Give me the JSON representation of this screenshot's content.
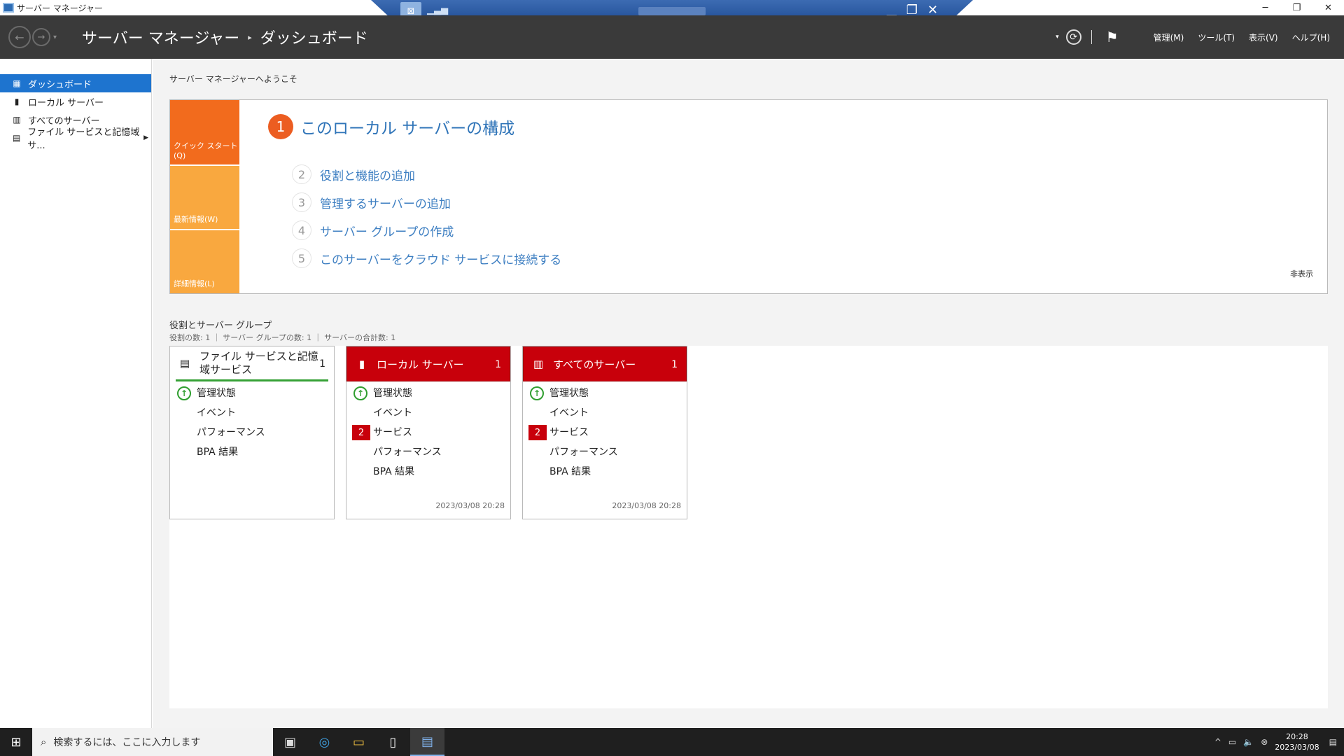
{
  "window": {
    "title": "サーバー マネージャー",
    "minimize": "─",
    "restore": "❐",
    "close": "✕"
  },
  "rdp": {
    "pin": "⊠",
    "signal": "▁▃▅",
    "min": "▁",
    "restore": "❐",
    "close": "✕"
  },
  "header": {
    "back": "←",
    "forward": "→",
    "nav_dropdown": "▾",
    "breadcrumb_root": "サーバー マネージャー",
    "breadcrumb_sep": "▸",
    "breadcrumb_current": "ダッシュボード",
    "dropdown": "▾",
    "refresh": "⟳",
    "flag": "⚑",
    "menus": [
      "管理(M)",
      "ツール(T)",
      "表示(V)",
      "ヘルプ(H)"
    ]
  },
  "sidebar": {
    "items": [
      {
        "label": "ダッシュボード",
        "icon": "dashboard-icon"
      },
      {
        "label": "ローカル サーバー",
        "icon": "server-icon"
      },
      {
        "label": "すべてのサーバー",
        "icon": "servers-icon"
      },
      {
        "label": "ファイル サービスと記憶域サ...",
        "icon": "file-services-icon"
      }
    ]
  },
  "welcome": "サーバー マネージャーへようこそ",
  "quickstart": {
    "tabs": [
      "クイック スタート(Q)",
      "最新情報(W)",
      "詳細情報(L)"
    ],
    "step1_num": "1",
    "step1_label": "このローカル サーバーの構成",
    "steps": [
      {
        "num": "2",
        "label": "役割と機能の追加"
      },
      {
        "num": "3",
        "label": "管理するサーバーの追加"
      },
      {
        "num": "4",
        "label": "サーバー グループの作成"
      },
      {
        "num": "5",
        "label": "このサーバーをクラウド サービスに接続する"
      }
    ],
    "hide": "非表示"
  },
  "roles": {
    "title": "役割とサーバー グループ",
    "subtitle": "役割の数: 1 ｜ サーバー グループの数: 1 ｜ サーバーの合計数: 1",
    "cards": [
      {
        "title": "ファイル サービスと記憶域サービス",
        "count": "1",
        "status": "green",
        "rows": [
          {
            "label": "管理状態",
            "mark": "ok"
          },
          {
            "label": "イベント"
          },
          {
            "label": "パフォーマンス"
          },
          {
            "label": "BPA 結果"
          }
        ],
        "date": ""
      },
      {
        "title": "ローカル サーバー",
        "count": "1",
        "status": "red",
        "rows": [
          {
            "label": "管理状態",
            "mark": "ok"
          },
          {
            "label": "イベント"
          },
          {
            "label": "サービス",
            "mark": "2"
          },
          {
            "label": "パフォーマンス"
          },
          {
            "label": "BPA 結果"
          }
        ],
        "date": "2023/03/08 20:28"
      },
      {
        "title": "すべてのサーバー",
        "count": "1",
        "status": "red",
        "rows": [
          {
            "label": "管理状態",
            "mark": "ok"
          },
          {
            "label": "イベント"
          },
          {
            "label": "サービス",
            "mark": "2"
          },
          {
            "label": "パフォーマンス"
          },
          {
            "label": "BPA 結果"
          }
        ],
        "date": "2023/03/08 20:28"
      }
    ]
  },
  "taskbar": {
    "start": "⊞",
    "search_placeholder": "検索するには、ここに入力します",
    "search_icon": "⌕",
    "apps": [
      "task-view-icon",
      "edge-icon",
      "explorer-icon",
      "notepad-icon",
      "server-manager-icon"
    ],
    "app_glyphs": [
      "▣",
      "◎",
      "▭",
      "▯",
      "▤"
    ],
    "tray": [
      "^",
      "▭",
      "🔈",
      "⊗"
    ],
    "time": "20:28",
    "date": "2023/03/08",
    "notify": "▤"
  },
  "colors": {
    "accent": "#1e74cf",
    "header_bg": "#3a3a3a",
    "quickstart_orange": "#f26b1d",
    "tab_orange": "#f9a83f",
    "alert_red": "#c8000b",
    "ok_green": "#35a135"
  }
}
